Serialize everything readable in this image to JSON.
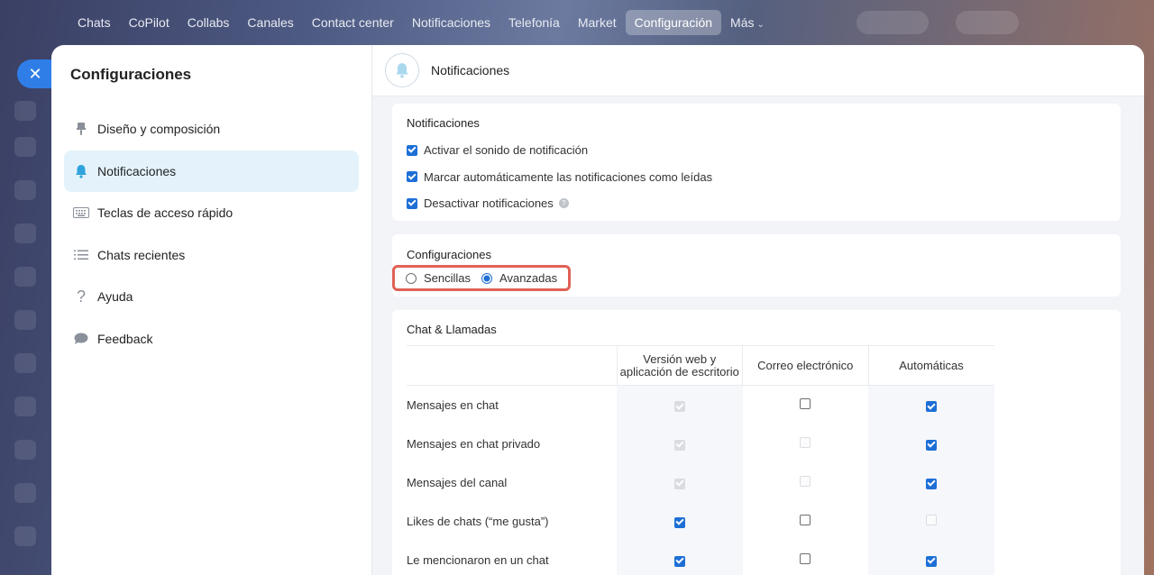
{
  "topnav": {
    "items": [
      {
        "label": "Chats"
      },
      {
        "label": "CoPilot"
      },
      {
        "label": "Collabs"
      },
      {
        "label": "Canales"
      },
      {
        "label": "Contact center"
      },
      {
        "label": "Notificaciones"
      },
      {
        "label": "Telefonía"
      },
      {
        "label": "Market"
      },
      {
        "label": "Configuración",
        "active": true
      },
      {
        "label": "Más"
      }
    ]
  },
  "sidebar": {
    "title": "Configuraciones",
    "items": [
      {
        "label": "Diseño y composición",
        "icon": "brush-icon"
      },
      {
        "label": "Notificaciones",
        "icon": "bell-icon",
        "active": true
      },
      {
        "label": "Teclas de acceso rápido",
        "icon": "keyboard-icon"
      },
      {
        "label": "Chats recientes",
        "icon": "list-icon"
      },
      {
        "label": "Ayuda",
        "icon": "question-icon"
      },
      {
        "label": "Feedback",
        "icon": "chat-bubble-icon"
      }
    ]
  },
  "main": {
    "header_title": "Notificaciones",
    "notifications_card": {
      "title": "Notificaciones",
      "options": [
        {
          "label": "Activar el sonido de notificación",
          "checked": true
        },
        {
          "label": "Marcar automáticamente las notificaciones como leídas",
          "checked": true
        },
        {
          "label": "Desactivar notificaciones",
          "checked": true,
          "help": "?"
        }
      ]
    },
    "settings_card": {
      "title": "Configuraciones",
      "radio_simple": "Sencillas",
      "radio_advanced": "Avanzadas",
      "selected": "Avanzadas"
    },
    "chat_card": {
      "title": "Chat & Llamadas",
      "columns": [
        "Versión web y aplicación de escritorio",
        "Correo electrónico",
        "Automáticas"
      ],
      "rows": [
        {
          "label": "Mensajes en chat",
          "states": [
            "dis-on",
            "off",
            "on"
          ]
        },
        {
          "label": "Mensajes en chat privado",
          "states": [
            "dis-on",
            "dis-off",
            "on"
          ]
        },
        {
          "label": "Mensajes del canal",
          "states": [
            "dis-on",
            "dis-off",
            "on"
          ]
        },
        {
          "label": "Likes de chats (“me gusta”)",
          "states": [
            "on",
            "off",
            "dis-off"
          ]
        },
        {
          "label": "Le mencionaron en un chat",
          "states": [
            "on",
            "off",
            "on"
          ]
        }
      ]
    }
  },
  "colors": {
    "accent": "#2f7ee8",
    "checkbox": "#1d6fd6",
    "highlight": "#e06155",
    "active_bg": "#e4f3fb"
  }
}
